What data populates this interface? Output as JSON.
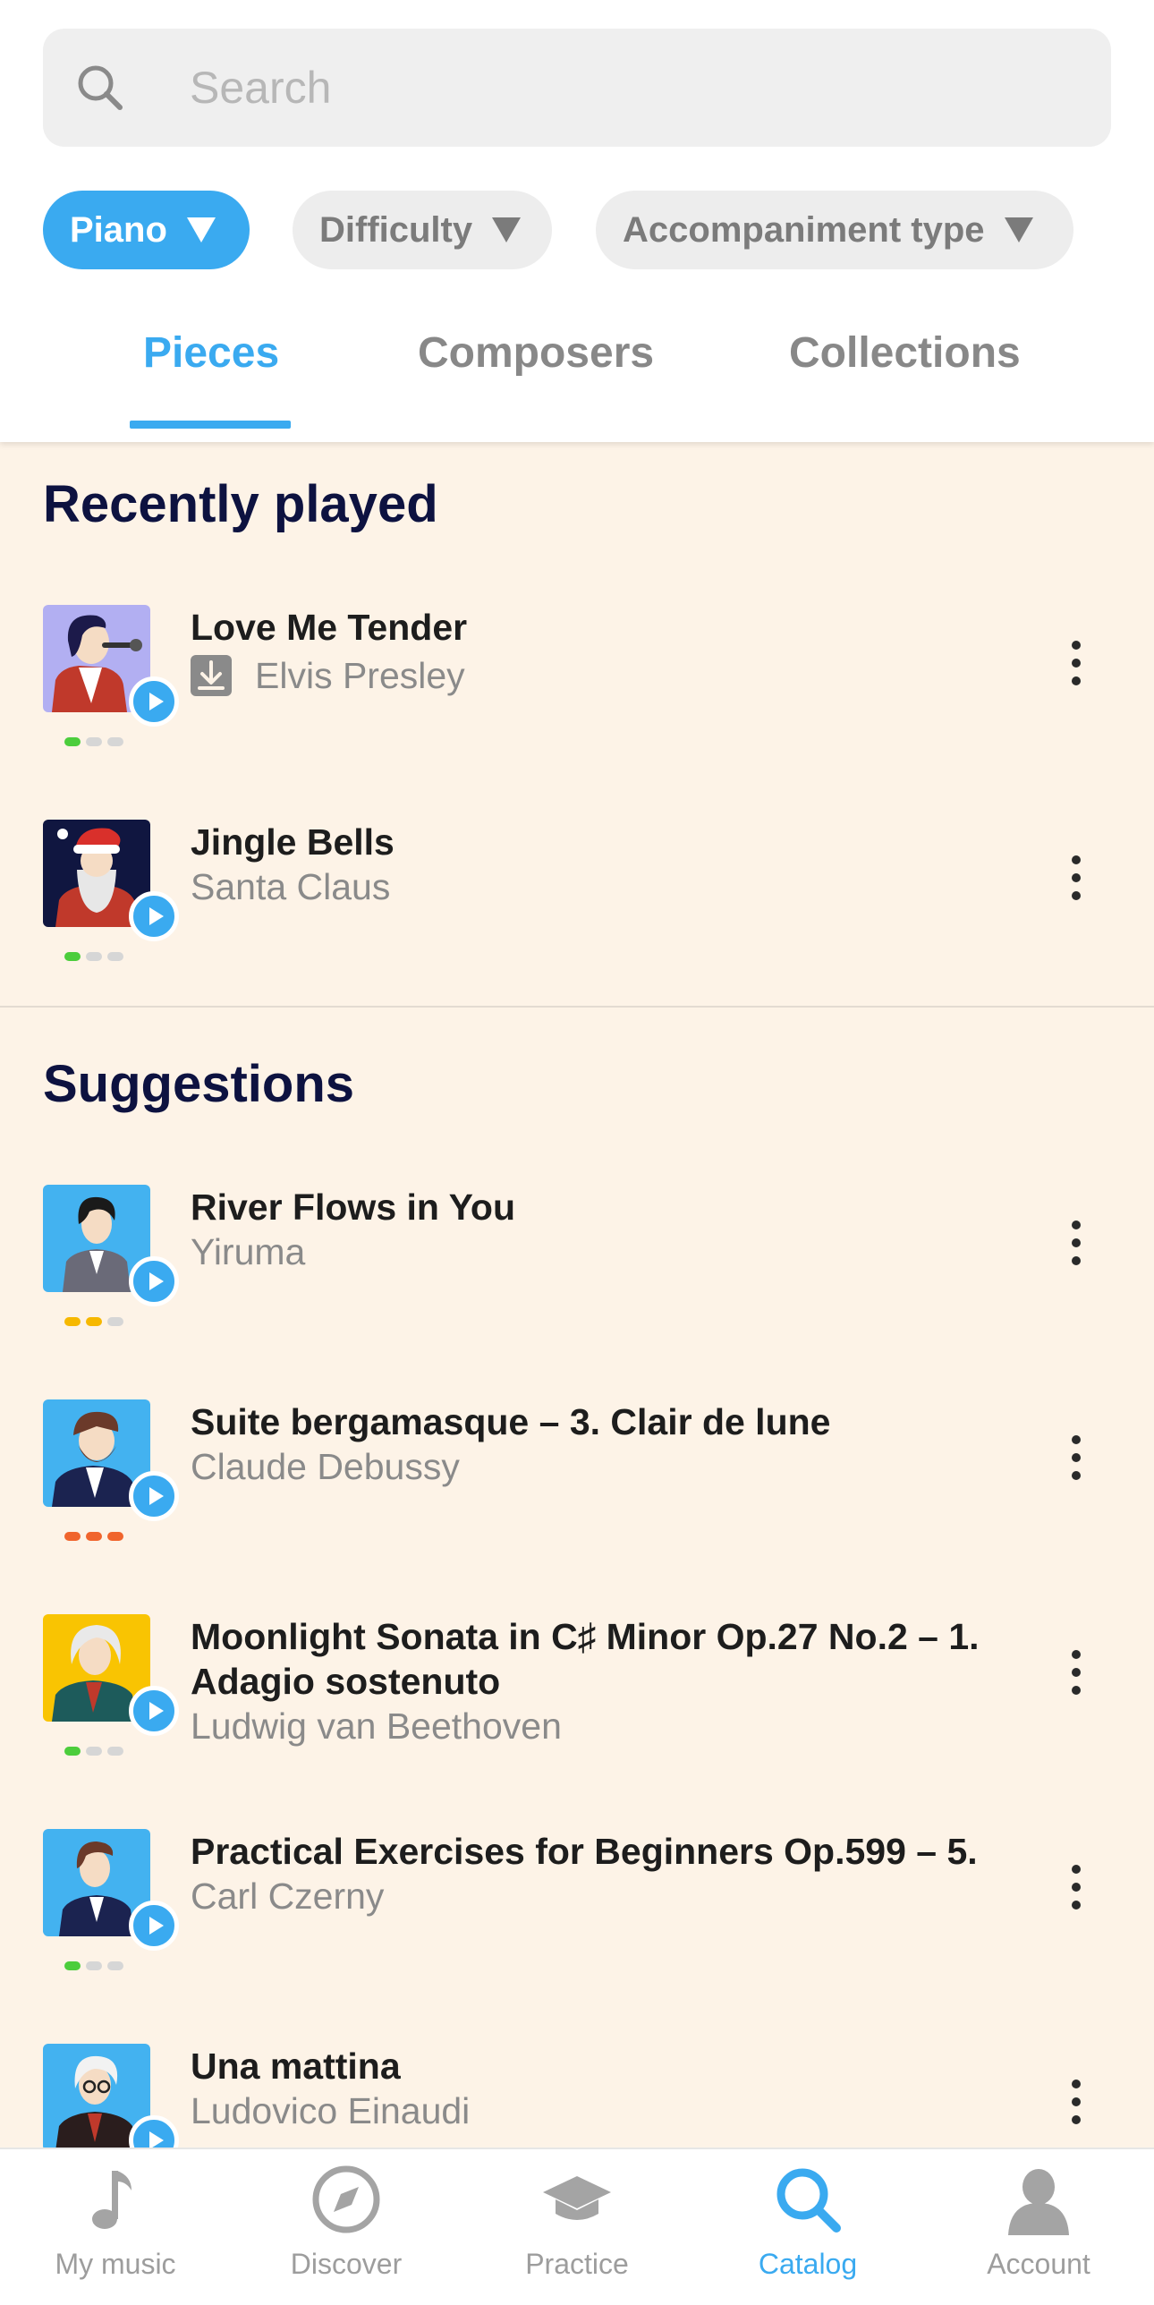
{
  "search": {
    "placeholder": "Search"
  },
  "filters": [
    {
      "label": "Piano",
      "active": true
    },
    {
      "label": "Difficulty",
      "active": false
    },
    {
      "label": "Accompaniment type",
      "active": false
    }
  ],
  "tabs": [
    {
      "label": "Pieces",
      "active": true
    },
    {
      "label": "Composers",
      "active": false
    },
    {
      "label": "Collections",
      "active": false
    }
  ],
  "recently_played": {
    "title": "Recently played",
    "items": [
      {
        "title": "Love Me Tender",
        "artist": "Elvis Presley",
        "downloaded": true,
        "difficulty_level": 1,
        "difficulty_color": "#4ccd3c"
      },
      {
        "title": "Jingle Bells",
        "artist": "Santa Claus",
        "downloaded": false,
        "difficulty_level": 1,
        "difficulty_color": "#4ccd3c"
      }
    ]
  },
  "suggestions": {
    "title": "Suggestions",
    "items": [
      {
        "title": "River Flows in You",
        "artist": "Yiruma",
        "difficulty_level": 2,
        "difficulty_color": "#f6b800"
      },
      {
        "title": "Suite bergamasque – 3. Clair de lune",
        "artist": "Claude Debussy",
        "difficulty_level": 3,
        "difficulty_color": "#f0642d"
      },
      {
        "title": "Moonlight Sonata in C♯ Minor Op.27 No.2 – 1. Adagio sostenuto",
        "artist": "Ludwig van Beethoven",
        "difficulty_level": 1,
        "difficulty_color": "#4ccd3c"
      },
      {
        "title": "Practical Exercises for Beginners Op.599 – 5.",
        "artist": "Carl Czerny",
        "difficulty_level": 1,
        "difficulty_color": "#4ccd3c"
      },
      {
        "title": "Una mattina",
        "artist": "Ludovico Einaudi",
        "difficulty_level": 1,
        "difficulty_color": "#4ccd3c"
      }
    ]
  },
  "bottom_nav": [
    {
      "label": "My music",
      "icon": "music-note-icon",
      "active": false
    },
    {
      "label": "Discover",
      "icon": "compass-icon",
      "active": false
    },
    {
      "label": "Practice",
      "icon": "graduation-cap-icon",
      "active": false
    },
    {
      "label": "Catalog",
      "icon": "search-icon",
      "active": true
    },
    {
      "label": "Account",
      "icon": "user-icon",
      "active": false
    }
  ],
  "colors": {
    "accent": "#3aaaf0",
    "background": "#fdf3e7",
    "heading": "#0d1240"
  }
}
